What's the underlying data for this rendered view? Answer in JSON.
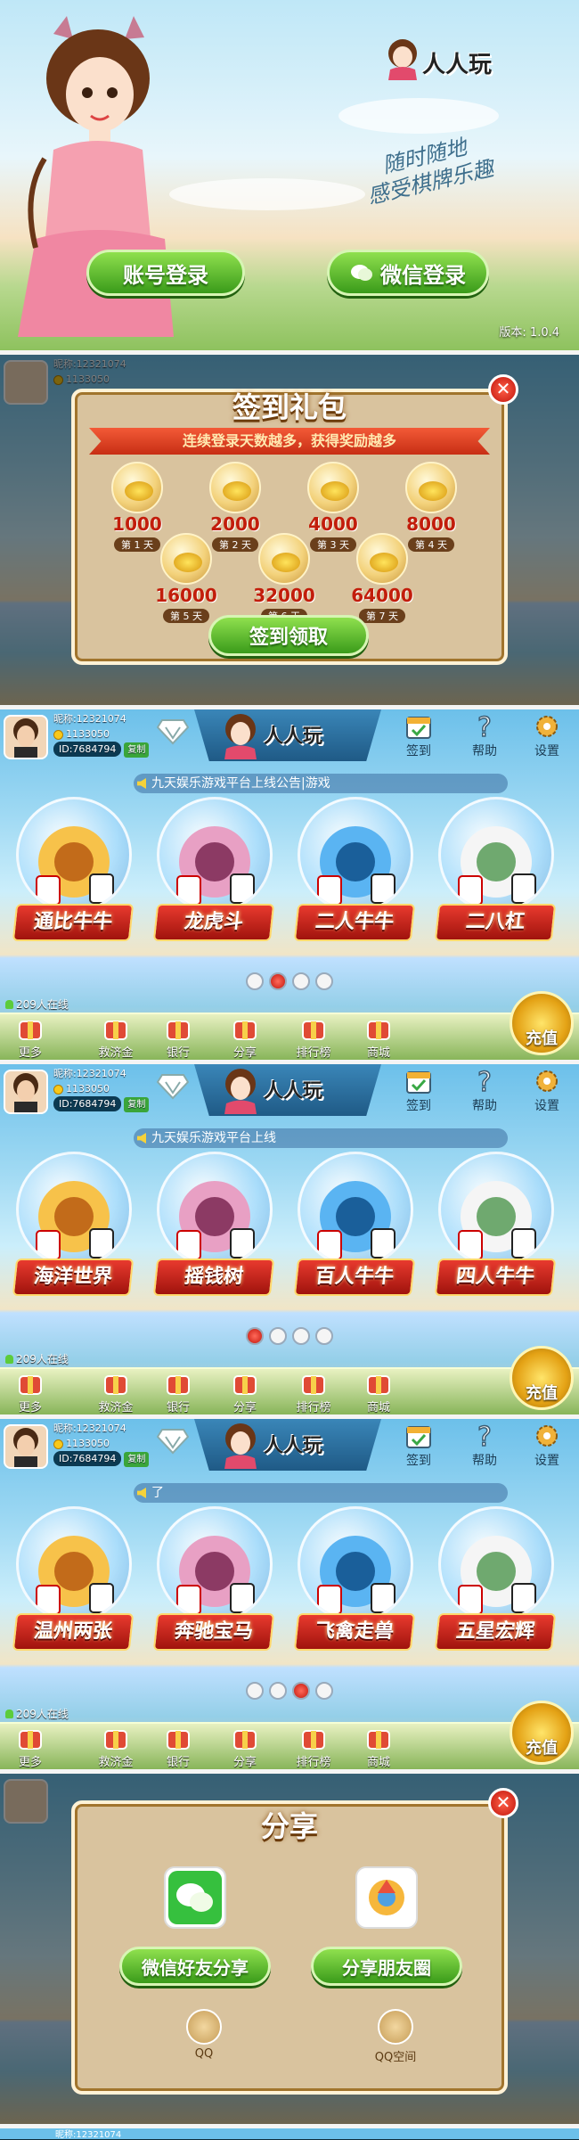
{
  "login": {
    "logo_text": "人人玩",
    "slogan_line1": "随时随地",
    "slogan_line2": "感受棋牌乐趣",
    "account_login": "账号登录",
    "wechat_login": "微信登录",
    "version": "版本: 1.0.4"
  },
  "user": {
    "nickname": "昵称:12321074",
    "coins": "1133050",
    "id": "ID:7684794",
    "copy": "复制"
  },
  "lobby": {
    "logo_text": "人人玩",
    "signin": "签到",
    "help": "帮助",
    "settings": "设置",
    "online": "209人在线",
    "bottom": {
      "more": "更多",
      "relief": "救济金",
      "bank": "银行",
      "share": "分享",
      "ranking": "排行榜",
      "shop": "商城",
      "recharge": "充值"
    }
  },
  "screens": [
    {
      "marquee": "九天娱乐游戏平台上线公告|游戏",
      "games": [
        "通比牛牛",
        "龙虎斗",
        "二人牛牛",
        "二八杠"
      ],
      "active_page": 2
    },
    {
      "marquee": "九天娱乐游戏平台上线",
      "games": [
        "海洋世界",
        "摇钱树",
        "百人牛牛",
        "四人牛牛"
      ],
      "active_page": 1
    },
    {
      "marquee": "了",
      "games": [
        "温州两张",
        "奔驰宝马",
        "飞禽走兽",
        "五星宏辉"
      ],
      "active_page": 3
    }
  ],
  "signin_dialog": {
    "title": "签到礼包",
    "ribbon": "连续登录天数越多，获得奖励越多",
    "rewards": [
      {
        "amount": "1000",
        "day": "第 1 天"
      },
      {
        "amount": "2000",
        "day": "第 2 天"
      },
      {
        "amount": "4000",
        "day": "第 3 天"
      },
      {
        "amount": "8000",
        "day": "第 4 天"
      },
      {
        "amount": "16000",
        "day": "第 5 天"
      },
      {
        "amount": "32000",
        "day": "第 6 天"
      },
      {
        "amount": "64000",
        "day": "第 7 天"
      }
    ],
    "claim": "签到领取"
  },
  "share_dialog": {
    "title": "分享",
    "wechat_friends": "微信好友分享",
    "moments": "分享朋友圈",
    "qq": "QQ",
    "qzone": "QQ空间"
  },
  "partial_nickname": "昵称:12321074",
  "colors": {
    "primary_green": "#3a9b1a",
    "banner_red": "#c4160d",
    "dialog_bg": "#d9c39e"
  }
}
